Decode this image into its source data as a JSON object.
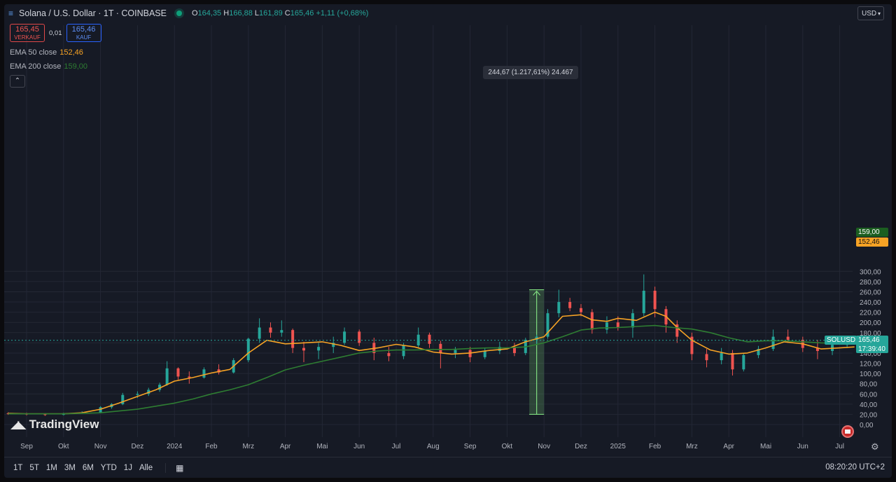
{
  "header": {
    "symbol_title": "Solana / U.S. Dollar · 1T · COINBASE",
    "ohlc": {
      "o_label": "O",
      "o": "164,35",
      "h_label": "H",
      "h": "166,88",
      "l_label": "L",
      "l": "161,89",
      "c_label": "C",
      "c": "165,46",
      "change": "+1,11 (+0,68%)"
    }
  },
  "trade": {
    "sell_price": "165,45",
    "sell_label": "VERKAUF",
    "spread": "0,01",
    "buy_price": "165,46",
    "buy_label": "KAUF"
  },
  "indicators": [
    {
      "name": "EMA 50 close",
      "value": "152,46",
      "color": "#f7a325"
    },
    {
      "name": "EMA 200 close",
      "value": "159,00",
      "color": "#2e7d32"
    }
  ],
  "currency": "USD",
  "brand": "TradingView",
  "measure_tooltip": "244,67 (1.217,61%) 24.467",
  "price_labels": {
    "symbol": "SOLUSD",
    "last": "165,46",
    "countdown": "17:39:40",
    "ema200": "159,00",
    "ema50": "152,46"
  },
  "timeframes": [
    "1T",
    "5T",
    "1M",
    "3M",
    "6M",
    "YTD",
    "1J",
    "Alle"
  ],
  "clock": "08:20:20 UTC+2",
  "colors": {
    "up": "#26a69a",
    "down": "#ef5350",
    "ema50": "#f7a325",
    "ema200": "#2e7d32",
    "measure": "#7fdc7f",
    "bg": "#161a25",
    "grid": "#232735"
  },
  "chart_data": {
    "type": "line",
    "title": "Solana / U.S. Dollar · 1T · COINBASE",
    "ylim": [
      0,
      300
    ],
    "y_ticks": [
      "0,00",
      "20,00",
      "40,00",
      "60,00",
      "80,00",
      "100,00",
      "120,00",
      "140,00",
      "160,00",
      "180,00",
      "200,00",
      "220,00",
      "240,00",
      "260,00",
      "280,00",
      "300,00"
    ],
    "x_ticks": [
      "Sep",
      "Okt",
      "Nov",
      "Dez",
      "2024",
      "Feb",
      "Mrz",
      "Apr",
      "Mai",
      "Jun",
      "Jul",
      "Aug",
      "Sep",
      "Okt",
      "Nov",
      "Dez",
      "2025",
      "Feb",
      "Mrz",
      "Apr",
      "Mai",
      "Jun",
      "Jul"
    ],
    "x_month_index": [
      0,
      1,
      2,
      3,
      4,
      5,
      6,
      7,
      8,
      9,
      10,
      11,
      12,
      13,
      14,
      15,
      16,
      17,
      18,
      19,
      20,
      21,
      22
    ],
    "series": [
      {
        "name": "EMA 50 close",
        "type": "line",
        "t": [
          -0.5,
          0,
          1,
          1.5,
          2,
          2.5,
          3,
          3.5,
          4,
          4.5,
          5,
          5.5,
          6,
          6.5,
          7,
          7.5,
          8,
          8.5,
          9,
          9.5,
          10,
          10.5,
          11,
          11.5,
          12,
          12.5,
          13,
          13.5,
          14,
          14.5,
          15,
          15.3,
          15.7,
          16,
          16.5,
          17,
          17.3,
          17.6,
          18,
          18.5,
          19,
          19.5,
          20,
          20.5,
          21,
          21.5,
          22,
          22.4
        ],
        "y": [
          22,
          21,
          21,
          23,
          30,
          42,
          55,
          68,
          85,
          92,
          101,
          108,
          140,
          165,
          158,
          160,
          162,
          155,
          145,
          150,
          157,
          152,
          142,
          138,
          140,
          145,
          148,
          162,
          172,
          212,
          215,
          205,
          202,
          208,
          204,
          220,
          212,
          190,
          165,
          146,
          138,
          140,
          150,
          162,
          158,
          148,
          150,
          152
        ]
      },
      {
        "name": "EMA 200 close",
        "type": "line",
        "t": [
          -0.5,
          0,
          1,
          2,
          3,
          4,
          4.5,
          5,
          5.5,
          6,
          6.5,
          7,
          7.5,
          8,
          8.5,
          9,
          9.5,
          10,
          10.5,
          11,
          11.5,
          12,
          12.5,
          13,
          13.5,
          14,
          14.5,
          15,
          15.5,
          16,
          16.5,
          17,
          17.5,
          18,
          18.5,
          19,
          19.5,
          20,
          20.5,
          21,
          21.5,
          22,
          22.4
        ],
        "y": [
          21,
          21,
          21,
          23,
          30,
          42,
          50,
          60,
          68,
          78,
          92,
          107,
          116,
          124,
          132,
          140,
          144,
          146,
          146,
          147,
          147,
          149,
          150,
          150,
          152,
          160,
          172,
          185,
          189,
          190,
          192,
          194,
          190,
          187,
          180,
          170,
          162,
          164,
          164,
          162,
          160,
          159,
          159
        ]
      }
    ],
    "candles": [
      {
        "t": -0.5,
        "o": 22,
        "h": 24,
        "l": 19,
        "c": 21
      },
      {
        "t": 0,
        "o": 21,
        "h": 23,
        "l": 18,
        "c": 20
      },
      {
        "t": 0.5,
        "o": 20,
        "h": 22,
        "l": 17,
        "c": 19
      },
      {
        "t": 1,
        "o": 19,
        "h": 23,
        "l": 18,
        "c": 22
      },
      {
        "t": 1.5,
        "o": 22,
        "h": 26,
        "l": 21,
        "c": 24
      },
      {
        "t": 2,
        "o": 24,
        "h": 36,
        "l": 23,
        "c": 34
      },
      {
        "t": 2.3,
        "o": 34,
        "h": 42,
        "l": 31,
        "c": 40
      },
      {
        "t": 2.6,
        "o": 40,
        "h": 62,
        "l": 38,
        "c": 58
      },
      {
        "t": 3,
        "o": 58,
        "h": 65,
        "l": 52,
        "c": 60
      },
      {
        "t": 3.3,
        "o": 60,
        "h": 72,
        "l": 56,
        "c": 68
      },
      {
        "t": 3.6,
        "o": 68,
        "h": 82,
        "l": 64,
        "c": 78
      },
      {
        "t": 3.8,
        "o": 78,
        "h": 124,
        "l": 76,
        "c": 110
      },
      {
        "t": 4.1,
        "o": 110,
        "h": 112,
        "l": 88,
        "c": 94
      },
      {
        "t": 4.4,
        "o": 94,
        "h": 104,
        "l": 80,
        "c": 92
      },
      {
        "t": 4.8,
        "o": 92,
        "h": 112,
        "l": 90,
        "c": 108
      },
      {
        "t": 5.2,
        "o": 108,
        "h": 118,
        "l": 98,
        "c": 102
      },
      {
        "t": 5.6,
        "o": 102,
        "h": 130,
        "l": 100,
        "c": 126
      },
      {
        "t": 6,
        "o": 126,
        "h": 170,
        "l": 122,
        "c": 168
      },
      {
        "t": 6.3,
        "o": 168,
        "h": 208,
        "l": 160,
        "c": 190
      },
      {
        "t": 6.6,
        "o": 190,
        "h": 200,
        "l": 170,
        "c": 180
      },
      {
        "t": 6.9,
        "o": 180,
        "h": 204,
        "l": 172,
        "c": 185
      },
      {
        "t": 7.2,
        "o": 185,
        "h": 188,
        "l": 140,
        "c": 150
      },
      {
        "t": 7.5,
        "o": 150,
        "h": 162,
        "l": 122,
        "c": 145
      },
      {
        "t": 7.9,
        "o": 145,
        "h": 160,
        "l": 128,
        "c": 152
      },
      {
        "t": 8.3,
        "o": 152,
        "h": 172,
        "l": 140,
        "c": 160
      },
      {
        "t": 8.6,
        "o": 160,
        "h": 190,
        "l": 156,
        "c": 182
      },
      {
        "t": 9,
        "o": 182,
        "h": 186,
        "l": 154,
        "c": 160
      },
      {
        "t": 9.4,
        "o": 160,
        "h": 170,
        "l": 126,
        "c": 140
      },
      {
        "t": 9.8,
        "o": 140,
        "h": 152,
        "l": 124,
        "c": 134
      },
      {
        "t": 10.2,
        "o": 134,
        "h": 160,
        "l": 128,
        "c": 155
      },
      {
        "t": 10.6,
        "o": 155,
        "h": 190,
        "l": 150,
        "c": 176
      },
      {
        "t": 10.9,
        "o": 176,
        "h": 180,
        "l": 150,
        "c": 158
      },
      {
        "t": 11.2,
        "o": 158,
        "h": 164,
        "l": 110,
        "c": 140
      },
      {
        "t": 11.6,
        "o": 140,
        "h": 152,
        "l": 130,
        "c": 146
      },
      {
        "t": 12,
        "o": 146,
        "h": 152,
        "l": 122,
        "c": 132
      },
      {
        "t": 12.4,
        "o": 132,
        "h": 150,
        "l": 128,
        "c": 144
      },
      {
        "t": 12.8,
        "o": 144,
        "h": 162,
        "l": 138,
        "c": 152
      },
      {
        "t": 13.2,
        "o": 152,
        "h": 160,
        "l": 134,
        "c": 140
      },
      {
        "t": 13.5,
        "o": 140,
        "h": 170,
        "l": 136,
        "c": 166
      },
      {
        "t": 13.8,
        "o": 166,
        "h": 176,
        "l": 156,
        "c": 172
      },
      {
        "t": 14.1,
        "o": 172,
        "h": 226,
        "l": 168,
        "c": 218
      },
      {
        "t": 14.4,
        "o": 218,
        "h": 264,
        "l": 210,
        "c": 240
      },
      {
        "t": 14.7,
        "o": 240,
        "h": 248,
        "l": 222,
        "c": 228
      },
      {
        "t": 15,
        "o": 228,
        "h": 236,
        "l": 212,
        "c": 220
      },
      {
        "t": 15.3,
        "o": 220,
        "h": 226,
        "l": 178,
        "c": 186
      },
      {
        "t": 15.7,
        "o": 186,
        "h": 212,
        "l": 178,
        "c": 200
      },
      {
        "t": 16,
        "o": 200,
        "h": 212,
        "l": 184,
        "c": 190
      },
      {
        "t": 16.4,
        "o": 190,
        "h": 226,
        "l": 170,
        "c": 218
      },
      {
        "t": 16.7,
        "o": 218,
        "h": 294,
        "l": 212,
        "c": 262
      },
      {
        "t": 17,
        "o": 262,
        "h": 270,
        "l": 210,
        "c": 226
      },
      {
        "t": 17.3,
        "o": 226,
        "h": 232,
        "l": 180,
        "c": 196
      },
      {
        "t": 17.6,
        "o": 196,
        "h": 204,
        "l": 160,
        "c": 172
      },
      {
        "t": 18,
        "o": 172,
        "h": 180,
        "l": 126,
        "c": 138
      },
      {
        "t": 18.4,
        "o": 138,
        "h": 148,
        "l": 112,
        "c": 126
      },
      {
        "t": 18.8,
        "o": 126,
        "h": 150,
        "l": 118,
        "c": 140
      },
      {
        "t": 19.1,
        "o": 140,
        "h": 146,
        "l": 96,
        "c": 108
      },
      {
        "t": 19.4,
        "o": 108,
        "h": 140,
        "l": 104,
        "c": 136
      },
      {
        "t": 19.8,
        "o": 136,
        "h": 154,
        "l": 130,
        "c": 148
      },
      {
        "t": 20.2,
        "o": 148,
        "h": 186,
        "l": 144,
        "c": 172
      },
      {
        "t": 20.6,
        "o": 172,
        "h": 186,
        "l": 160,
        "c": 166
      },
      {
        "t": 21,
        "o": 166,
        "h": 172,
        "l": 142,
        "c": 150
      },
      {
        "t": 21.4,
        "o": 150,
        "h": 166,
        "l": 128,
        "c": 144
      },
      {
        "t": 21.8,
        "o": 144,
        "h": 162,
        "l": 136,
        "c": 156
      },
      {
        "t": 22.2,
        "o": 156,
        "h": 168,
        "l": 150,
        "c": 165
      }
    ],
    "annotations": [
      {
        "type": "price_range",
        "from_price": 20,
        "to_price": 264,
        "t_from": 13.6,
        "t_to": 14.0,
        "label": "244,67 (1.217,61%) 24.467"
      }
    ]
  }
}
